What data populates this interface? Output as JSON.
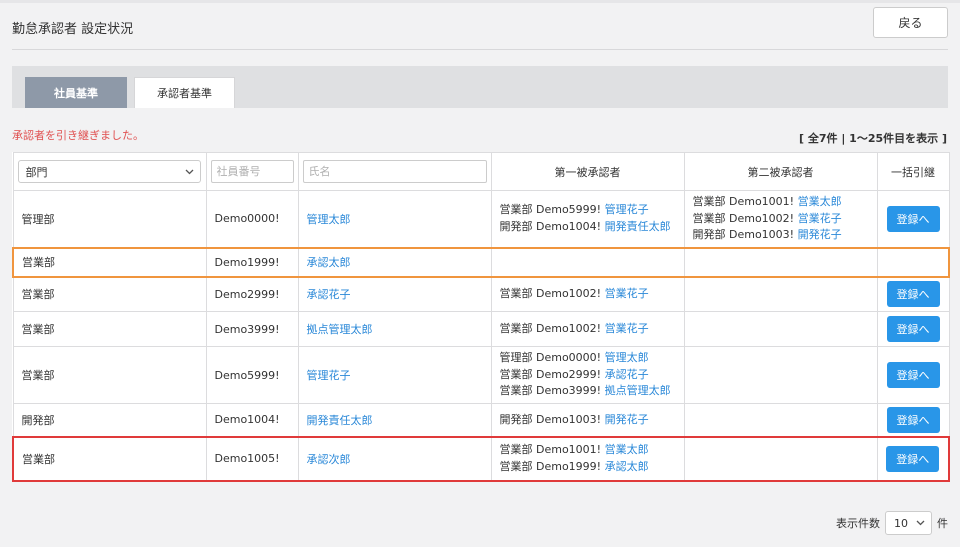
{
  "header": {
    "title": "勤怠承認者 設定状況",
    "back_label": "戻る"
  },
  "tabs": [
    {
      "label": "社員基準"
    },
    {
      "label": "承認者基準"
    }
  ],
  "message": "承認者を引き継ぎました。",
  "record_count": "[ 全7件 | 1〜25件目を表示 ]",
  "filters": {
    "department_value": "部門",
    "employee_no_placeholder": "社員番号",
    "name_placeholder": "氏名"
  },
  "columns": {
    "first_approver": "第一被承認者",
    "second_approver": "第二被承認者",
    "bulk": "一括引継"
  },
  "register_label": "登録へ",
  "rows": [
    {
      "dept": "管理部",
      "emp_no": "Demo0000!",
      "name": "管理太郎",
      "first": [
        {
          "pre": "営業部 Demo5999! ",
          "link": "管理花子"
        },
        {
          "pre": "開発部 Demo1004! ",
          "link": "開発責任太郎"
        }
      ],
      "second": [
        {
          "pre": "営業部 Demo1001! ",
          "link": "営業太郎"
        },
        {
          "pre": "営業部 Demo1002! ",
          "link": "営業花子"
        },
        {
          "pre": "開発部 Demo1003! ",
          "link": "開発花子"
        }
      ],
      "has_button": true,
      "highlight": ""
    },
    {
      "dept": "営業部",
      "emp_no": "Demo1999!",
      "name": "承認太郎",
      "first": [],
      "second": [],
      "has_button": false,
      "highlight": "orange"
    },
    {
      "dept": "営業部",
      "emp_no": "Demo2999!",
      "name": "承認花子",
      "first": [
        {
          "pre": "営業部 Demo1002! ",
          "link": "営業花子"
        }
      ],
      "second": [],
      "has_button": true,
      "highlight": ""
    },
    {
      "dept": "営業部",
      "emp_no": "Demo3999!",
      "name": "拠点管理太郎",
      "first": [
        {
          "pre": "営業部 Demo1002! ",
          "link": "営業花子"
        }
      ],
      "second": [],
      "has_button": true,
      "highlight": ""
    },
    {
      "dept": "営業部",
      "emp_no": "Demo5999!",
      "name": "管理花子",
      "first": [
        {
          "pre": "管理部 Demo0000! ",
          "link": "管理太郎"
        },
        {
          "pre": "営業部 Demo2999! ",
          "link": "承認花子"
        },
        {
          "pre": "営業部 Demo3999! ",
          "link": "拠点管理太郎"
        }
      ],
      "second": [],
      "has_button": true,
      "highlight": ""
    },
    {
      "dept": "開発部",
      "emp_no": "Demo1004!",
      "name": "開発責任太郎",
      "first": [
        {
          "pre": "開発部 Demo1003! ",
          "link": "開発花子"
        }
      ],
      "second": [],
      "has_button": true,
      "highlight": ""
    },
    {
      "dept": "営業部",
      "emp_no": "Demo1005!",
      "name": "承認次郎",
      "first": [
        {
          "pre": "営業部 Demo1001! ",
          "link": "営業太郎"
        },
        {
          "pre": "営業部 Demo1999! ",
          "link": "承認太郎"
        }
      ],
      "second": [],
      "has_button": true,
      "highlight": "red"
    }
  ],
  "pager": {
    "label": "表示件数",
    "value": "10",
    "suffix": "件"
  },
  "colors": {
    "tab_active": "#8e99a8",
    "link": "#2a88d8",
    "button": "#2996e8",
    "message": "#e05050",
    "highlight_orange": "#f0953e",
    "highlight_red": "#e03a3a"
  }
}
